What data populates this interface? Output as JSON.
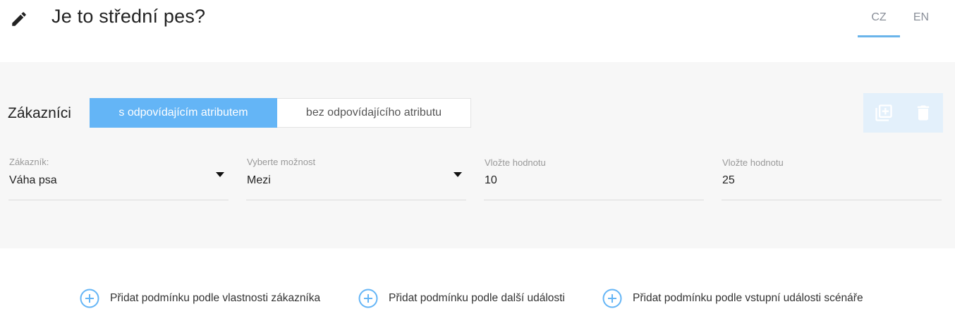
{
  "header": {
    "title": "Je to střední pes?",
    "languages": [
      {
        "code": "CZ",
        "active": true
      },
      {
        "code": "EN",
        "active": false
      }
    ],
    "accent_color": "#6ab4ea"
  },
  "condition": {
    "label": "Zákazníci",
    "toggle": {
      "with_attribute": "s odpovídajícím atributem",
      "without_attribute": "bez odpovídajícího atributu",
      "selected": "with_attribute"
    },
    "fields": [
      {
        "label": "Zákazník:",
        "value": "Váha psa",
        "type": "select"
      },
      {
        "label": "Vyberte možnost",
        "value": "Mezi",
        "type": "select"
      },
      {
        "label": "Vložte hodnotu",
        "value": "10",
        "type": "input"
      },
      {
        "label": "Vložte hodnotu",
        "value": "25",
        "type": "input"
      }
    ],
    "actions": [
      "duplicate-icon",
      "trash-icon"
    ]
  },
  "add_buttons": [
    {
      "label": "Přidat podmínku podle vlastnosti zákazníka"
    },
    {
      "label": "Přidat podmínku podle další události"
    },
    {
      "label": "Přidat podmínku podle vstupní události scénáře"
    }
  ],
  "colors": {
    "primary": "#64b5f6",
    "panel_bg": "#f7f7f7",
    "action_bg": "#e3f0fb"
  }
}
